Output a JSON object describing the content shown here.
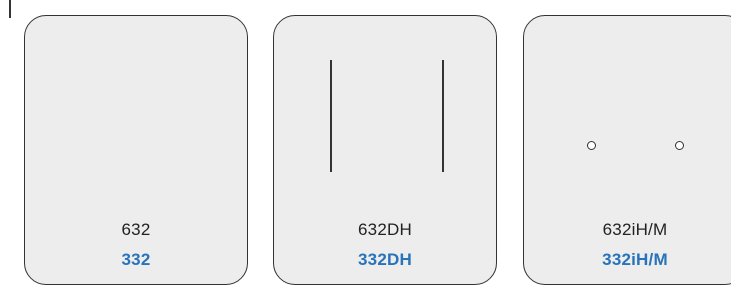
{
  "cards": [
    {
      "model": "632",
      "variant": "332",
      "feature": "none"
    },
    {
      "model": "632DH",
      "variant": "332DH",
      "feature": "two vertical lines"
    },
    {
      "model": "632iH/M",
      "variant": "332iH/M",
      "feature": "two small circles"
    }
  ],
  "colors": {
    "card_background": "#ededed",
    "card_border": "#333333",
    "model_text": "#222222",
    "variant_text": "#2873b9"
  }
}
